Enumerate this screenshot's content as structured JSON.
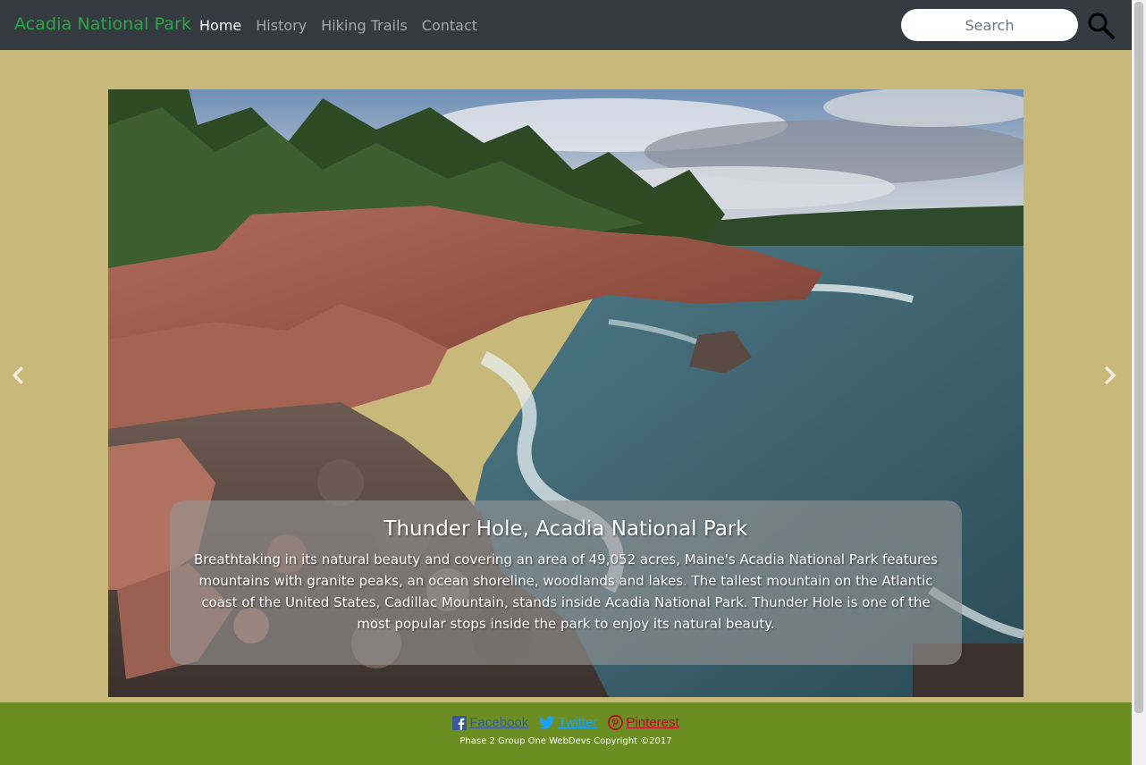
{
  "navbar": {
    "brand": "Acadia National Park",
    "links": [
      {
        "label": "Home",
        "active": true
      },
      {
        "label": "History",
        "active": false
      },
      {
        "label": "Hiking Trails",
        "active": false
      },
      {
        "label": "Contact",
        "active": false
      }
    ],
    "search_placeholder": "Search",
    "search_icon": "search-icon"
  },
  "carousel": {
    "prev_icon": "chevron-left-icon",
    "next_icon": "chevron-right-icon",
    "slide": {
      "image": "rocky coastline with evergreen forest, ocean waves and cloudy sky",
      "caption_title": "Thunder Hole, Acadia National Park",
      "caption_text": "Breathtaking in its natural beauty and covering an area of 49,052 acres, Maine's Acadia National Park features mountains with granite peaks, an ocean shoreline, woodlands and lakes. The tallest mountain on the Atlantic coast of the United States, Cadillac Mountain, stands inside Acadia National Park. Thunder Hole is one of the most popular stops inside the park to enjoy its natural beauty."
    }
  },
  "footer": {
    "social": [
      {
        "label": "Facebook",
        "icon": "facebook-icon",
        "color": "#3b5998"
      },
      {
        "label": "Twitter",
        "icon": "twitter-icon",
        "color": "#1da1f2"
      },
      {
        "label": "Pinterest",
        "icon": "pinterest-icon",
        "color": "#bd081c"
      }
    ],
    "copyright": "Phase 2 Group One WebDevs Copyright ©2017"
  },
  "colors": {
    "navbar_bg": "#343a40",
    "brand": "#28a745",
    "page_bg": "#c8b97a",
    "footer_bg": "#6b8e23"
  }
}
